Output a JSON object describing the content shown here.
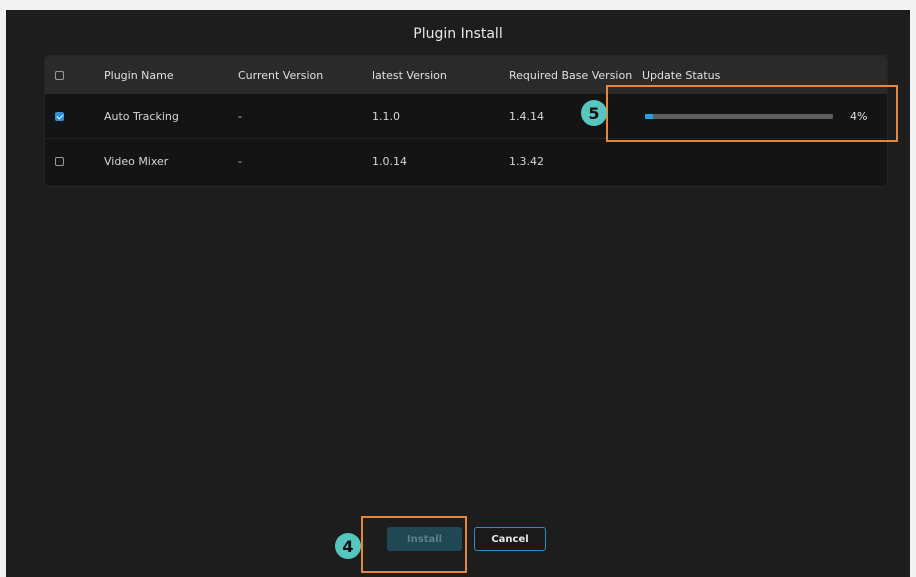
{
  "dialog": {
    "title": "Plugin Install"
  },
  "table": {
    "headers": {
      "name": "Plugin Name",
      "current": "Current Version",
      "latest": "latest Version",
      "required": "Required Base Version",
      "status": "Update Status"
    },
    "rows": [
      {
        "checked": true,
        "name": "Auto Tracking",
        "current": "-",
        "latest": "1.1.0",
        "required": "1.4.14",
        "progress_percent": 4,
        "progress_label": "4%"
      },
      {
        "checked": false,
        "name": "Video Mixer",
        "current": "-",
        "latest": "1.0.14",
        "required": "1.3.42"
      }
    ]
  },
  "buttons": {
    "install": "Install",
    "cancel": "Cancel"
  },
  "annotations": {
    "badge_install": "4",
    "badge_status": "5"
  },
  "colors": {
    "accent": "#1aa3e8",
    "highlight": "#e8873a",
    "badge": "#56c7be"
  }
}
